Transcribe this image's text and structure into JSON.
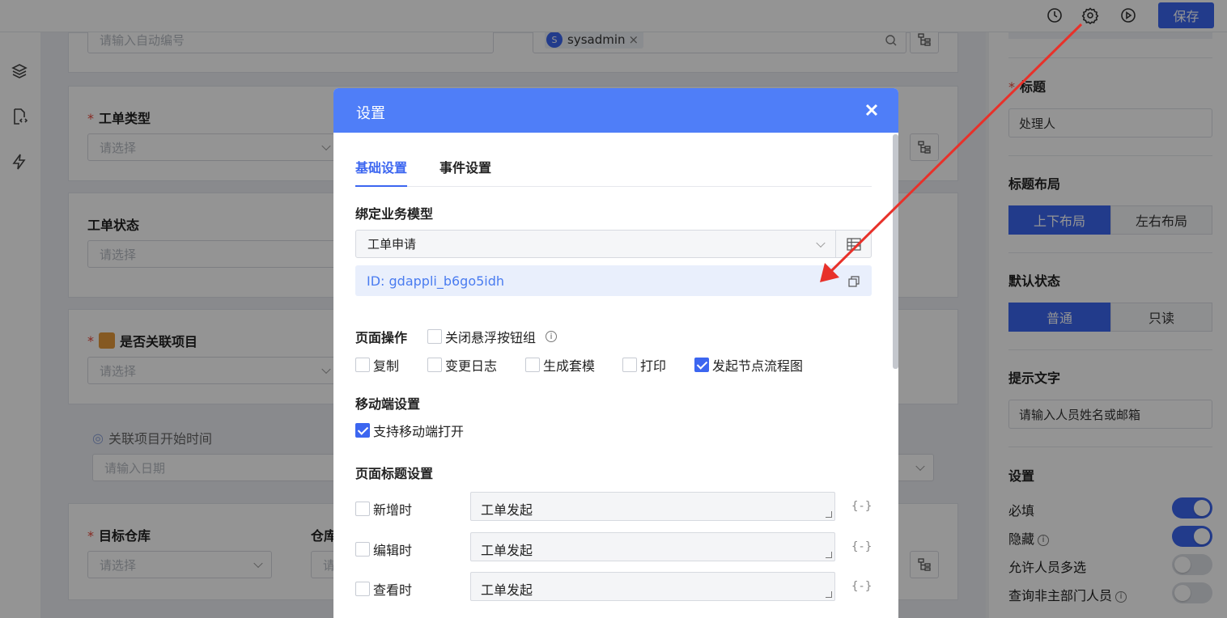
{
  "topbar": {
    "save_label": "保存",
    "icons": [
      "clock-icon",
      "gear-icon",
      "play-icon"
    ]
  },
  "left_rail": {
    "icons": [
      "layers-icon",
      "document-code-icon",
      "bolt-icon"
    ]
  },
  "form": {
    "auto_number": {
      "placeholder": "请输入自动编号"
    },
    "user_picker": {
      "tag_initial": "S",
      "tag_text": "sysadmin"
    },
    "ticket_type": {
      "label": "工单类型",
      "placeholder": "请选择"
    },
    "ticket_status": {
      "label": "工单状态",
      "placeholder": "请选择"
    },
    "related_project": {
      "label": "是否关联项目",
      "placeholder": "请选择"
    },
    "project_start": {
      "label": "关联项目开始时间",
      "placeholder": "请输入日期"
    },
    "target_warehouse": {
      "label": "目标仓库",
      "placeholder": "请选择"
    },
    "warehouse2": {
      "label": "仓库",
      "placeholder": "请"
    }
  },
  "right_panel": {
    "title_label": "标题",
    "title_value": "处理人",
    "layout_label": "标题布局",
    "layout_options": [
      "上下布局",
      "左右布局"
    ],
    "layout_selected": 0,
    "default_state_label": "默认状态",
    "state_options": [
      "普通",
      "只读"
    ],
    "state_selected": 0,
    "hint_label": "提示文字",
    "hint_value": "请输入人员姓名或邮箱",
    "settings_label": "设置",
    "switches": [
      {
        "label": "必填",
        "on": true,
        "info": false
      },
      {
        "label": "隐藏",
        "on": true,
        "info": true
      },
      {
        "label": "允许人员多选",
        "on": false,
        "info": false
      },
      {
        "label": "查询非主部门人员",
        "on": false,
        "info": true
      }
    ]
  },
  "modal": {
    "title": "设置",
    "tabs": [
      "基础设置",
      "事件设置"
    ],
    "active_tab": 0,
    "bind_model_label": "绑定业务模型",
    "bind_model_value": "工单申请",
    "model_id": "ID: gdappli_b6go5idh",
    "page_ops_label": "页面操作",
    "close_float_label": "关闭悬浮按钮组",
    "page_ops": [
      {
        "label": "复制",
        "checked": false
      },
      {
        "label": "变更日志",
        "checked": false
      },
      {
        "label": "生成套模",
        "checked": false
      },
      {
        "label": "打印",
        "checked": false
      },
      {
        "label": "发起节点流程图",
        "checked": true
      }
    ],
    "mobile_label": "移动端设置",
    "mobile_open_label": "支持移动端打开",
    "mobile_open_checked": true,
    "page_title_label": "页面标题设置",
    "title_rows": [
      {
        "label": "新增时",
        "value": "工单发起"
      },
      {
        "label": "编辑时",
        "value": "工单发起"
      },
      {
        "label": "查看时",
        "value": "工单发起"
      }
    ]
  },
  "annotation": {
    "arrow_color": "#e8312a"
  },
  "colors": {
    "primary": "#3c66f0",
    "modal_header": "#4f7ef8",
    "id_text": "#4a7cf0"
  }
}
